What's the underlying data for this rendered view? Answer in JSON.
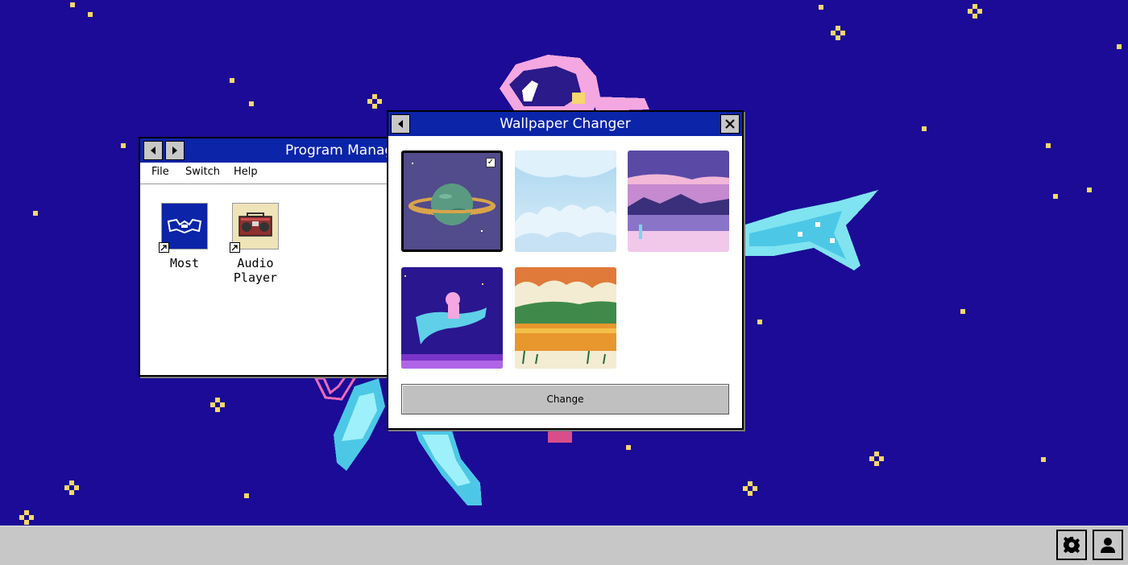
{
  "program_manager": {
    "title": "Program Manager",
    "menu": [
      "File",
      "Switch",
      "Help"
    ],
    "apps": [
      {
        "label": "Most",
        "icon": "most-app-icon"
      },
      {
        "label": "Audio\nPlayer",
        "icon": "boombox-icon"
      }
    ]
  },
  "wallpaper_changer": {
    "title": "Wallpaper Changer",
    "change_label": "Change",
    "wallpapers": [
      {
        "name": "planet",
        "selected": true
      },
      {
        "name": "clouds",
        "selected": false
      },
      {
        "name": "purple-lake",
        "selected": false
      },
      {
        "name": "astronaut-whale",
        "selected": false
      },
      {
        "name": "autumn-lake",
        "selected": false
      }
    ]
  },
  "taskbar": {
    "buttons": [
      "gear-icon",
      "user-icon"
    ]
  },
  "colors": {
    "desktop": "#1b0b96",
    "titlebar": "#0b24a8",
    "taskbar": "#c7c7c7",
    "star": "#f6d76b"
  }
}
